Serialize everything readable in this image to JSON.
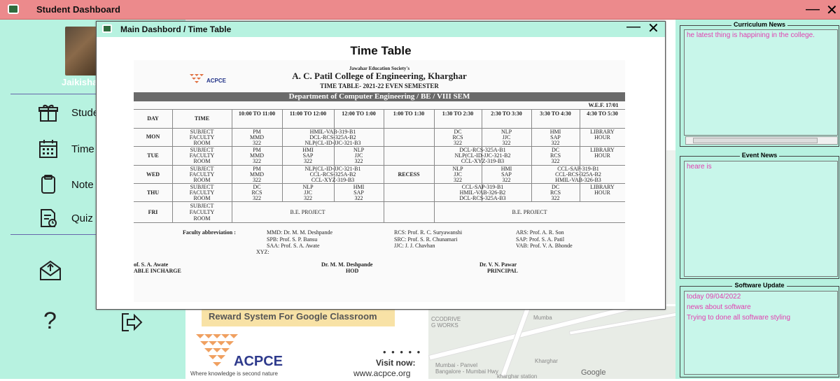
{
  "window": {
    "title": "Student Dashboard",
    "min": "—",
    "close": "✕"
  },
  "sidebar": {
    "user_name": "Jaikisha",
    "items": [
      {
        "label": "Stude",
        "icon": "gift-icon"
      },
      {
        "label": "Time",
        "icon": "calendar-icon"
      },
      {
        "label": "Note",
        "icon": "note-icon"
      },
      {
        "label": "Quiz",
        "icon": "quiz-icon"
      }
    ],
    "help": "?"
  },
  "dialog": {
    "title": "Main Dashbord / Time Table",
    "min": "—",
    "close": "✕",
    "heading": "Time Table",
    "timetable": {
      "society": "Jawahar Education Society's",
      "college": "A. C. Patil College of Engineering, Kharghar",
      "term": "TIME TABLE- 2021-22 EVEN SEMESTER",
      "dept": "Department of Computer Engineering / BE / VIII SEM",
      "wef": "W.E.F. 17/01",
      "day_col": "DAY",
      "time_col": "TIME",
      "slots": [
        "10:00 TO 11:00",
        "11:00 TO 12:00",
        "12:00 TO 1:00",
        "1:00 TO 1:30",
        "1:30 TO 2:30",
        "2:30 TO 3:30",
        "3:30 TO 4:30",
        "4:30 TO 5:30"
      ],
      "days": [
        "MON",
        "TUE",
        "WED",
        "THU",
        "FRI"
      ],
      "row_labels": [
        "SUBJECT",
        "FACULTY",
        "ROOM"
      ],
      "recess": "RECESS",
      "mon": {
        "subject": [
          "PM",
          "HMIL-VAB-319-B1",
          "DC",
          "NLP",
          "HMI",
          "LIBRARY"
        ],
        "faculty": [
          "MMD",
          "DCL-RCS-325A-B2",
          "RCS",
          "JJC",
          "SAP",
          "HOUR"
        ],
        "room": [
          "322",
          "NLP(CL-ID-JJC-321-B3",
          "322",
          "322",
          "322"
        ]
      },
      "tue": {
        "subject": [
          "PM",
          "HMI",
          "NLP",
          "DCL-RCS-325A-B1",
          "DC",
          "LIBRARY"
        ],
        "faculty": [
          "MMD",
          "SAP",
          "JJC",
          "NLP(CL-ID-JJC-321-B2",
          "RCS",
          "HOUR"
        ],
        "room": [
          "322",
          "322",
          "322",
          "CCL-XYZ-319-B3",
          "322"
        ]
      },
      "wed": {
        "subject": [
          "PM",
          "NLP(CL-ID-JJC-321-B1",
          "NLP",
          "HMI",
          "CCL-SAP-319-B1"
        ],
        "faculty": [
          "MMD",
          "CCL-RCS-325A-B2",
          "JJC",
          "SAP",
          "CCL-RCS-325A-B2"
        ],
        "room": [
          "322",
          "CCL-XYZ-319-B3",
          "322",
          "322",
          "HMIL-VAB-326-B3"
        ]
      },
      "thu": {
        "subject": [
          "DC",
          "NLP",
          "HMI",
          "CCL-SAP-319-B1",
          "DC",
          "LIBRARY"
        ],
        "faculty": [
          "RCS",
          "JJC",
          "SAP",
          "HMIL-VAB-326-B2",
          "RCS",
          "HOUR"
        ],
        "room": [
          "322",
          "322",
          "322",
          "DCL-RCS-325A-B3",
          "322"
        ]
      },
      "fri": {
        "left": "B.E. PROJECT",
        "right": "B.E. PROJECT"
      },
      "abbr_label": "Faculty abbreviation :",
      "abbr": [
        "MMD: Dr. M. M. Deshpande",
        "RCS: Prof. R. C. Suryawanshi",
        "ARS: Prof. A. R. Son",
        "SPB: Prof. S. P. Bansu",
        "SRC: Prof. S. R. Chunamari",
        "SAP: Prof. S. A. Patil",
        "SAA: Prof. S. A. Awate",
        "JJC: J. J. Chavhan",
        "VAB: Prof. V. A. Bhonde",
        "XYZ:"
      ],
      "sign": [
        "of. S. A. Awate",
        "ABLE INCHARGE",
        "Dr. M. M. Deshpande",
        "HOD",
        "Dr. V. N. Pawar",
        "PRINCIPAL"
      ]
    }
  },
  "promo": {
    "reward": "Reward  System For Google  Classroom",
    "brand": "ACPCE",
    "tagline": "Where knowledge is second nature",
    "dots": "• • • • •",
    "visit": "Visit now:",
    "site": "www.acpce.org"
  },
  "map": {
    "labels": [
      "CCODRIVE\nG WORKS",
      "Mumbai - Panvel\nBangalore - Mumbai Hwy",
      "Kharghar",
      "kharghar station",
      "Mumba"
    ],
    "google": "Google"
  },
  "news": {
    "curriculum_title": "Curriculum News",
    "curriculum_text": "he latest thing is happining in the college.",
    "event_title": "Event News",
    "event_text": "heare is",
    "software_title": "Software Update",
    "software_lines": [
      "today 09/04/2022",
      "news about software",
      "Trying to done all software styling"
    ]
  }
}
